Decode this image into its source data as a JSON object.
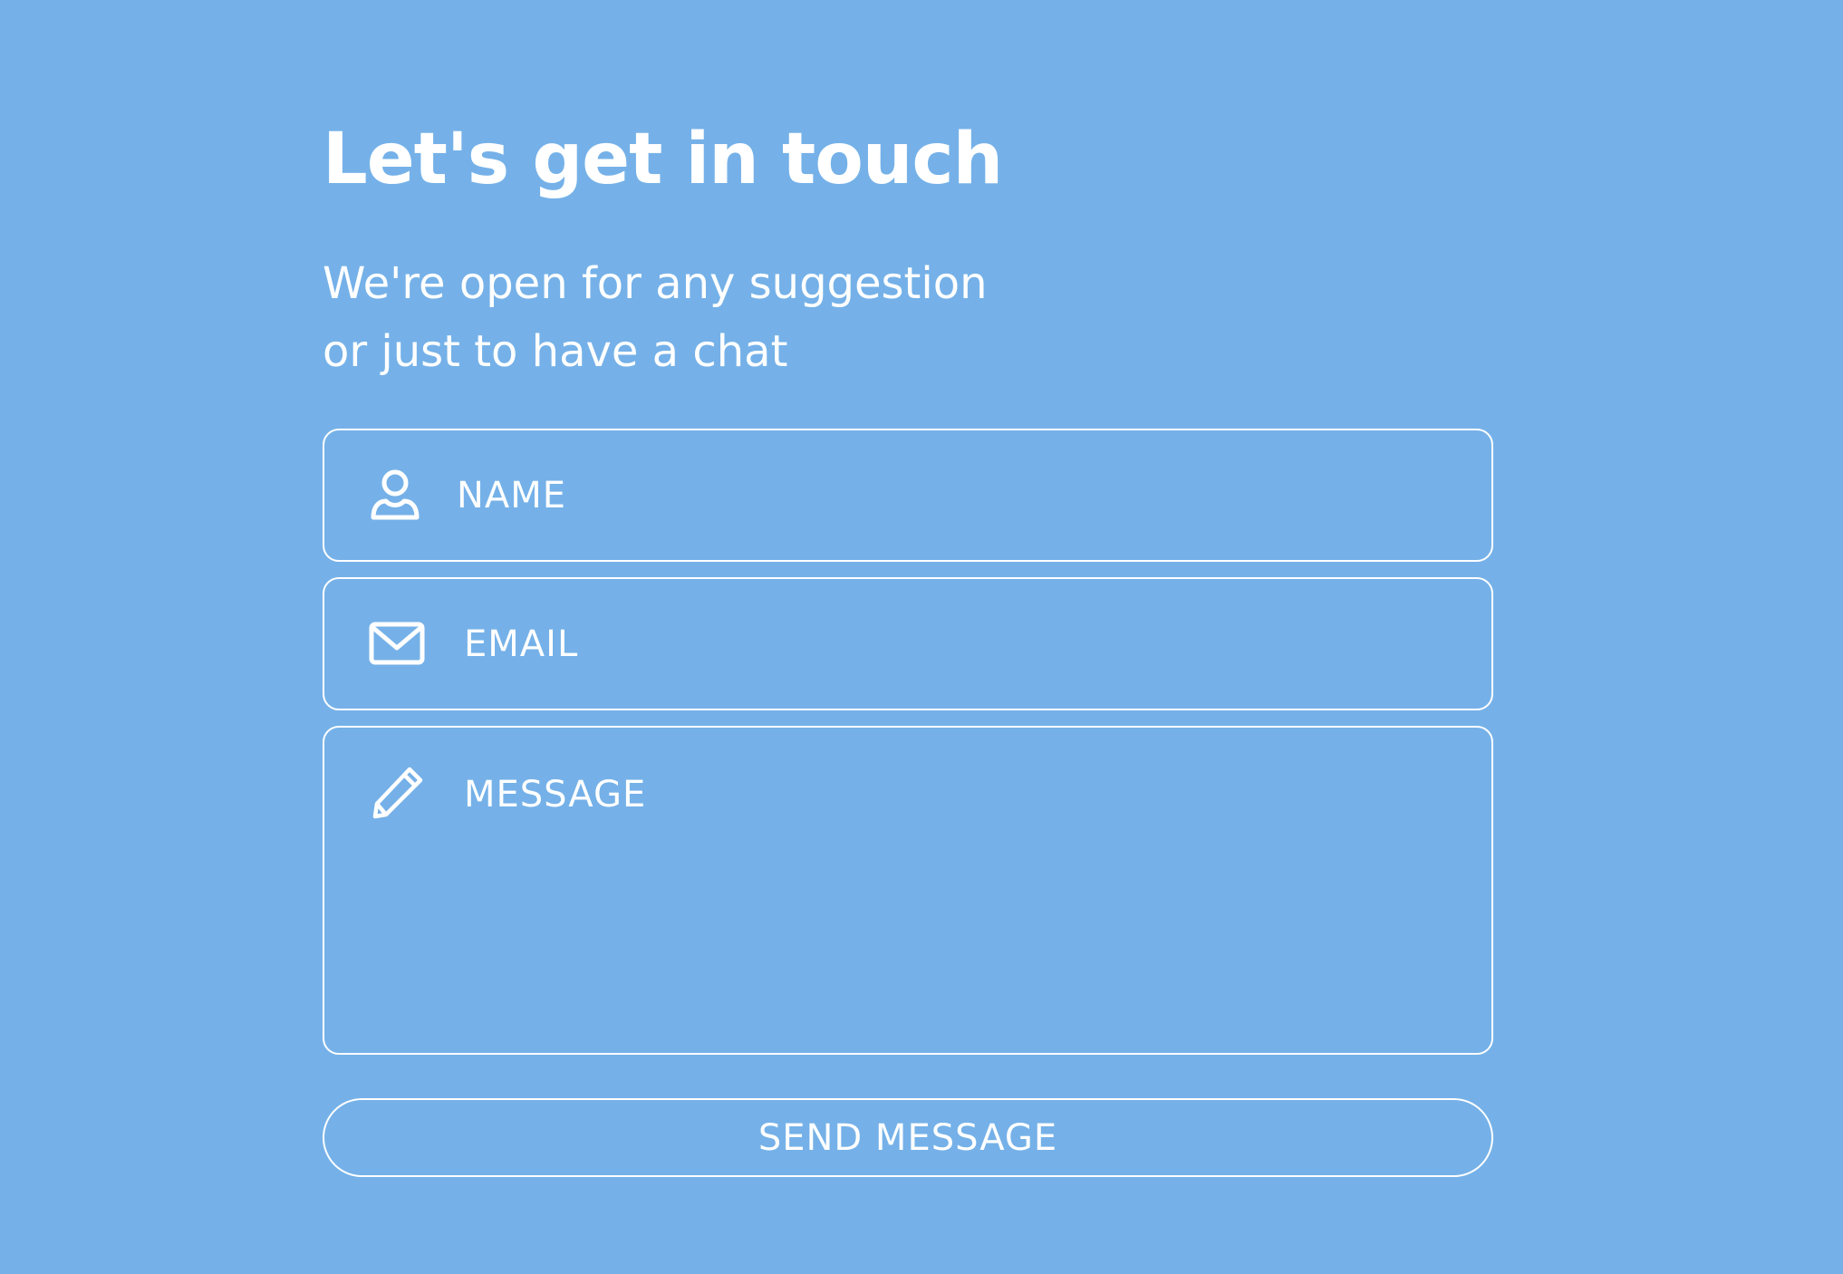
{
  "header": {
    "title": "Let's get in touch",
    "subtitle_line1": "We're open for any suggestion",
    "subtitle_line2": "or just to have a chat"
  },
  "form": {
    "name": {
      "placeholder": "NAME",
      "value": "",
      "icon": "user-icon"
    },
    "email": {
      "placeholder": "EMAIL",
      "value": "",
      "icon": "envelope-icon"
    },
    "message": {
      "placeholder": "MESSAGE",
      "value": "",
      "icon": "pencil-icon"
    },
    "submit_label": "SEND MESSAGE"
  },
  "colors": {
    "background": "#75b1e8",
    "foreground": "#ffffff"
  }
}
